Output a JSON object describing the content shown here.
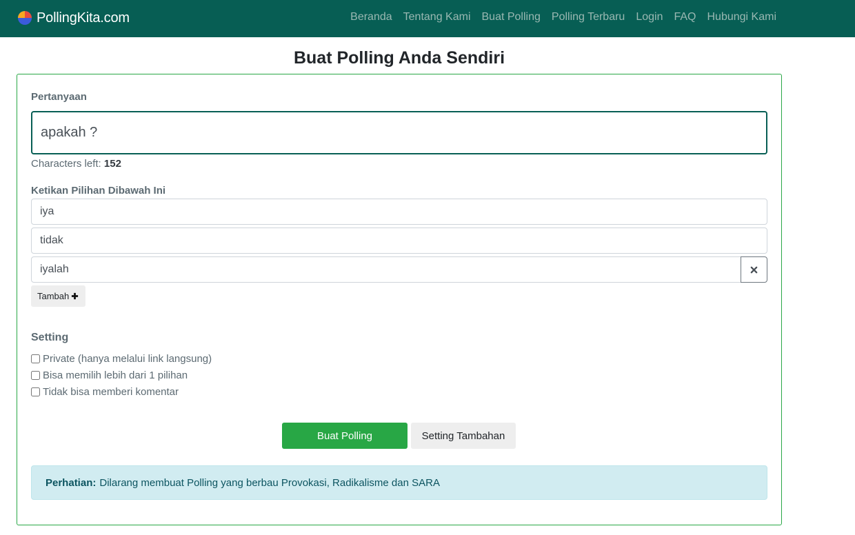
{
  "brand": {
    "name": "PollingKita.com",
    "icon": "pie-chart-logo-icon",
    "colors": [
      "#f6a821",
      "#e74c3c",
      "#3b5bdb"
    ]
  },
  "nav": {
    "items": [
      "Beranda",
      "Tentang Kami",
      "Buat Polling",
      "Polling Terbaru",
      "Login",
      "FAQ",
      "Hubungi Kami"
    ]
  },
  "page": {
    "title": "Buat Polling Anda Sendiri"
  },
  "form": {
    "question_label": "Pertanyaan",
    "question_value": "apakah ?",
    "chars_left_label": "Characters left:",
    "chars_left_count": "152",
    "options_label": "Ketikan Pilihan Dibawah Ini",
    "options": [
      "iya",
      "tidak",
      "iyalah"
    ],
    "remove_icon": "close-icon",
    "add_label": "Tambah",
    "add_icon": "plus-icon",
    "setting_label": "Setting",
    "settings": [
      {
        "label": "Private (hanya melalui link langsung)",
        "checked": false
      },
      {
        "label": "Bisa memilih lebih dari 1 pilihan",
        "checked": false
      },
      {
        "label": "Tidak bisa memberi komentar",
        "checked": false
      }
    ],
    "submit_label": "Buat Polling",
    "more_settings_label": "Setting Tambahan"
  },
  "alert": {
    "title": "Perhatian:",
    "message": "Dilarang membuat Polling yang berbau Provokasi, Radikalisme dan SARA"
  },
  "colors": {
    "navbar": "#075e54",
    "accent": "#28a745",
    "alert_bg": "#d1ecf1",
    "alert_text": "#0c5460"
  }
}
